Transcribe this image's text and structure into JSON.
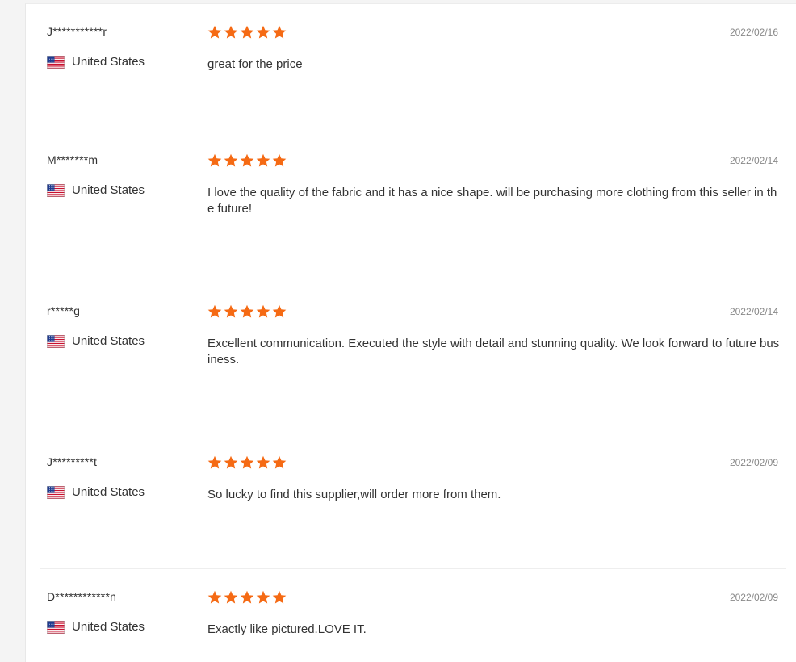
{
  "colors": {
    "star": "#f56a14",
    "text": "#333333",
    "date": "#888888",
    "divider": "#eeeeee"
  },
  "reviews": [
    {
      "buyer": "J***********r",
      "country": "United States",
      "flag_icon": "us-flag-icon",
      "rating": 5,
      "date": "2022/02/16",
      "text": "great for the price"
    },
    {
      "buyer": "M*******m",
      "country": "United States",
      "flag_icon": "us-flag-icon",
      "rating": 5,
      "date": "2022/02/14",
      "text": "I love the quality of the fabric and it has a nice shape. will be purchasing more clothing from this seller in the future!"
    },
    {
      "buyer": "r*****g",
      "country": "United States",
      "flag_icon": "us-flag-icon",
      "rating": 5,
      "date": "2022/02/14",
      "text": "Excellent communication. Executed the style with detail and stunning quality. We look forward to future business."
    },
    {
      "buyer": "J*********t",
      "country": "United States",
      "flag_icon": "us-flag-icon",
      "rating": 5,
      "date": "2022/02/09",
      "text": "So lucky to find this supplier,will order more from them."
    },
    {
      "buyer": "D************n",
      "country": "United States",
      "flag_icon": "us-flag-icon",
      "rating": 5,
      "date": "2022/02/09",
      "text": "Exactly like pictured.LOVE IT."
    }
  ]
}
